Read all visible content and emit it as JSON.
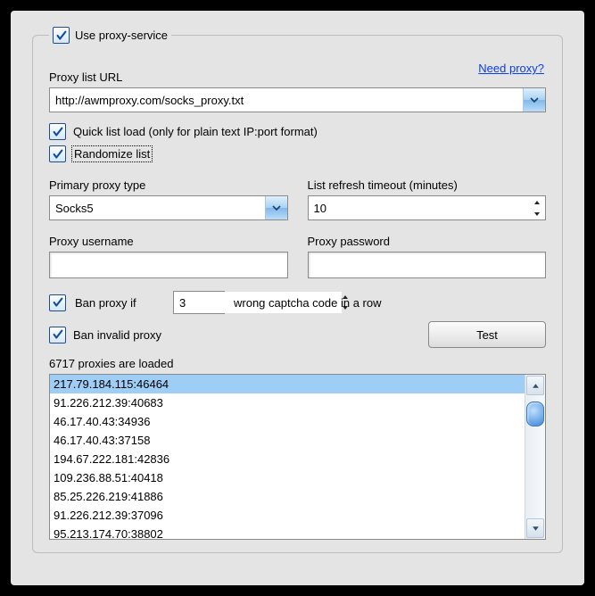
{
  "legend": {
    "label": "Use proxy-service"
  },
  "need_proxy": "Need proxy?",
  "url_label": "Proxy list URL",
  "url_value": "http://awmproxy.com/socks_proxy.txt",
  "quick_label": "Quick list load (only for plain text IP:port format)",
  "randomize_label": "Randomize list",
  "primary_label": "Primary proxy type",
  "primary_value": "Socks5",
  "refresh_label": "List refresh timeout (minutes)",
  "refresh_value": "10",
  "user_label": "Proxy username",
  "pass_label": "Proxy password",
  "user_value": "",
  "pass_value": "",
  "ban_if_label": "Ban proxy if",
  "ban_if_value": "3",
  "ban_if_tail": "wrong captcha code in a row",
  "ban_invalid_label": "Ban invalid proxy",
  "test_label": "Test",
  "status": "6717 proxies are loaded",
  "proxies": [
    "217.79.184.115:46464",
    "91.226.212.39:40683",
    "46.17.40.43:34936",
    "46.17.40.43:37158",
    "194.67.222.181:42836",
    "109.236.88.51:40418",
    "85.25.226.219:41886",
    "91.226.212.39:37096",
    "95.213.174.70:38802"
  ],
  "selected_index": 0
}
